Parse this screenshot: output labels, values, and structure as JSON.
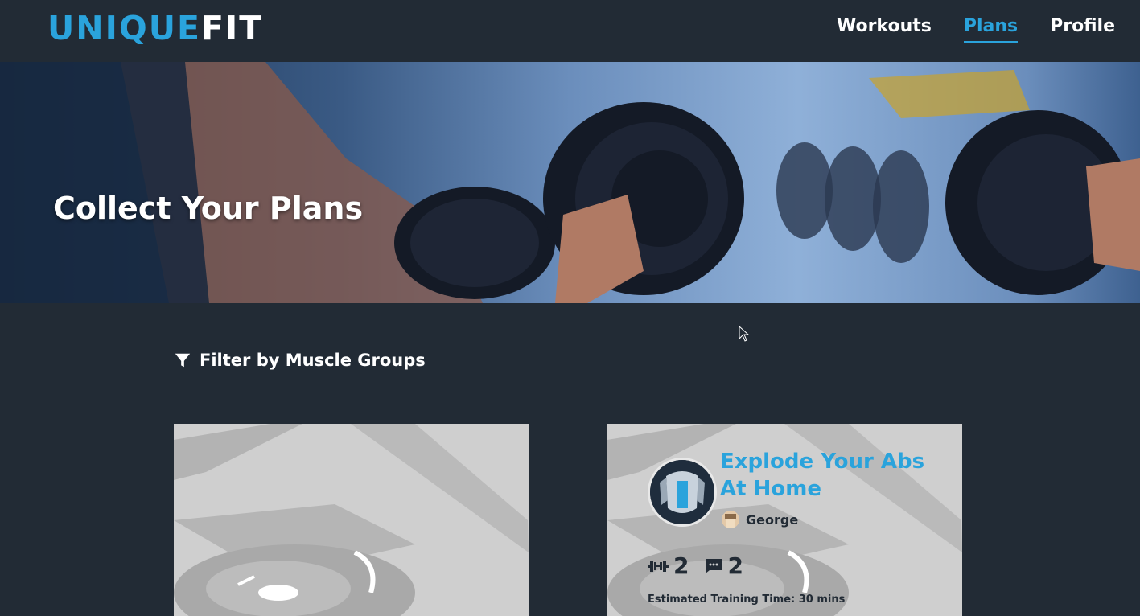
{
  "brand": {
    "name_part1": "UNIQUE",
    "name_part2": "FIT"
  },
  "nav": {
    "items": [
      {
        "label": "Workouts",
        "active": false
      },
      {
        "label": "Plans",
        "active": true
      },
      {
        "label": "Profile",
        "active": false
      }
    ]
  },
  "hero": {
    "title": "Collect Your Plans"
  },
  "filter": {
    "label": "Filter by Muscle Groups",
    "icon": "filter-icon"
  },
  "plans": [
    {
      "title": "",
      "author": "",
      "workouts": "",
      "comments": "",
      "training_time": ""
    },
    {
      "title": "Explode Your Abs At Home",
      "author": "George",
      "workouts": "2",
      "comments": "2",
      "training_time": "Estimated Training Time: 30 mins"
    }
  ],
  "colors": {
    "accent": "#2aa3dc",
    "background": "#222b35",
    "card": "#cfcfcf"
  }
}
